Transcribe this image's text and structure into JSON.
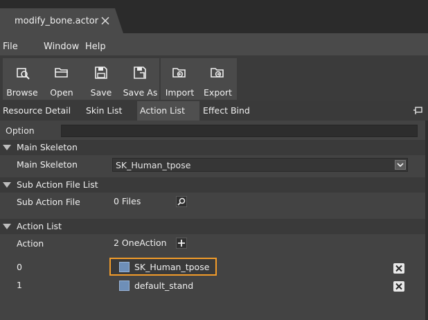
{
  "tabs": [
    {
      "title": "modify_bone.actor",
      "close_icon": "close-icon"
    }
  ],
  "menu": [
    "File",
    "Window",
    "Help"
  ],
  "toolbar": {
    "buttons": [
      {
        "label": "Browse",
        "icon": "browse-icon"
      },
      {
        "label": "Open",
        "icon": "folder-open-icon"
      },
      {
        "label": "Save",
        "icon": "save-icon"
      },
      {
        "label": "Save As",
        "icon": "save-as-icon"
      },
      {
        "label": "Import",
        "icon": "import-icon"
      },
      {
        "label": "Export",
        "icon": "export-icon"
      }
    ]
  },
  "panel_tabs": [
    {
      "label": "Resource Detail",
      "active": false
    },
    {
      "label": "Skin List",
      "active": false
    },
    {
      "label": "Action List",
      "active": true
    },
    {
      "label": "Effect Bind",
      "active": false
    }
  ],
  "option": {
    "label": "Option",
    "value": ""
  },
  "sections": {
    "main_skeleton": {
      "header": "Main Skeleton",
      "row_label": "Main Skeleton",
      "value": "SK_Human_tpose"
    },
    "sub_action": {
      "header": "Sub Action File List",
      "row_label": "Sub Action File",
      "value": "0 Files"
    },
    "action_list": {
      "header": "Action List",
      "row_label": "Action",
      "value": "2 OneAction",
      "items": [
        {
          "index": "0",
          "name": "SK_Human_tpose",
          "highlighted": true
        },
        {
          "index": "1",
          "name": "default_stand",
          "highlighted": false
        }
      ]
    }
  },
  "colors": {
    "highlight": "#f39c2a",
    "panel": "#434343",
    "menubar": "#4a4a4a"
  }
}
